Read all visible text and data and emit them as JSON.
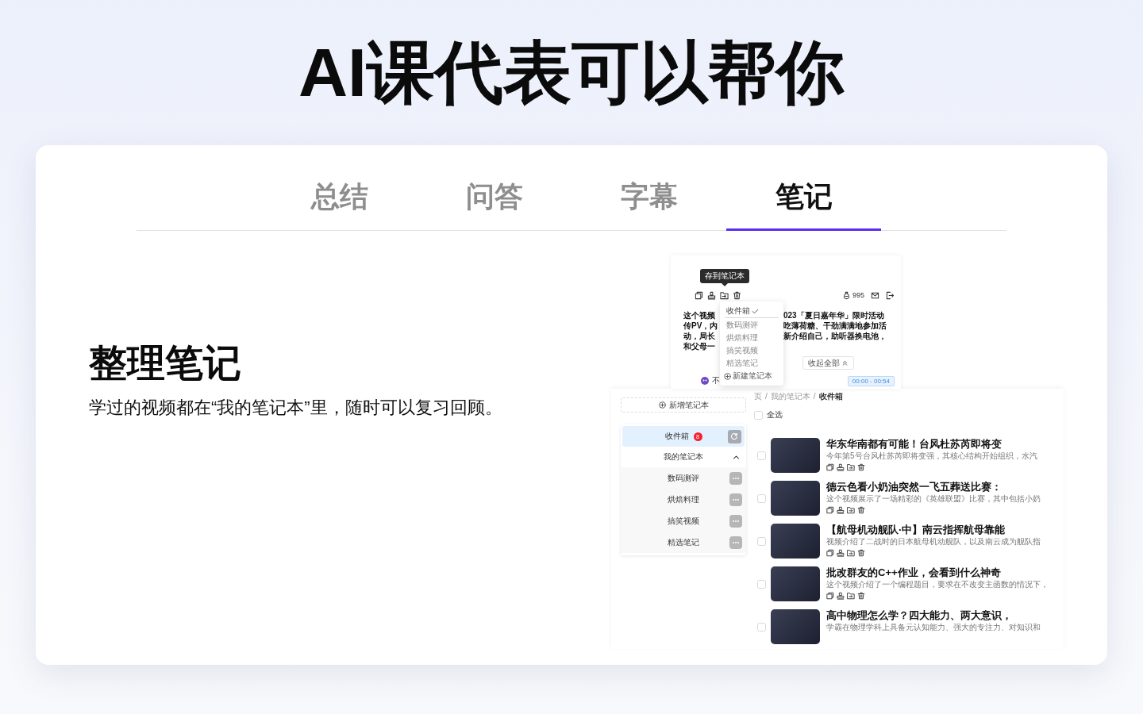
{
  "headline": "AI课代表可以帮你",
  "tabs": [
    {
      "label": "总结",
      "selected": false
    },
    {
      "label": "问答",
      "selected": false
    },
    {
      "label": "字幕",
      "selected": false
    },
    {
      "label": "笔记",
      "selected": true
    }
  ],
  "feature": {
    "title": "整理笔记",
    "description": "学过的视频都在“我的笔记本”里，随时可以复习回顾。"
  },
  "note_popup": {
    "tooltip": "存到笔记本",
    "coin_count": "995",
    "text_left": [
      "这个视频",
      "传PV，内",
      "动，局长",
      "和父母一"
    ],
    "text_right": [
      "023「夏日嘉年华」限时活动",
      "吃薄荷糖、干劲满满地参加活",
      "新介绍自己，助听器换电池，"
    ],
    "menu": {
      "items": [
        {
          "label": "收件箱",
          "selected": true
        },
        {
          "label": "数码测评",
          "selected": false
        },
        {
          "label": "烘焙料理",
          "selected": false
        },
        {
          "label": "搞笑视频",
          "selected": false
        },
        {
          "label": "精选笔记",
          "selected": false
        }
      ],
      "new_label": "新建笔记本"
    },
    "collapse_button": "收起全部",
    "speaker_text": "不",
    "time_range": "00:00 - 00:54"
  },
  "notebook_panel": {
    "new_button": "新增笔记本",
    "sidebar": [
      {
        "kind": "inbox",
        "label": "收件箱",
        "selected": true,
        "badge": "8"
      },
      {
        "kind": "group",
        "label": "我的笔记本",
        "selected": false,
        "expanded": true,
        "children": [
          {
            "label": "数码测评",
            "selected": false
          },
          {
            "label": "烘焙料理",
            "selected": false
          },
          {
            "label": "搞笑视频",
            "selected": false
          },
          {
            "label": "精选笔记",
            "selected": false
          }
        ]
      }
    ],
    "breadcrumb": {
      "separator": "/",
      "items": [
        {
          "label": "页",
          "current": false
        },
        {
          "label": "我的笔记本",
          "current": false
        },
        {
          "label": "收件箱",
          "current": true
        }
      ]
    },
    "select_all": {
      "label": "全选",
      "checked": false
    },
    "videos": [
      {
        "title": "华东华南都有可能！台风杜苏芮即将变",
        "description": "今年第5号台风杜苏芮即将变强，其核心结构开始组织，水汽",
        "checked": false,
        "show_actions": true
      },
      {
        "title": "德云色看小奶油突然一飞五葬送比赛：",
        "description": "这个视频展示了一场精彩的《英雄联盟》比赛，其中包括小奶",
        "checked": false,
        "show_actions": true
      },
      {
        "title": "【航母机动舰队·中】南云指挥航母靠能",
        "description": "视频介绍了二战时的日本航母机动舰队，以及南云成为舰队指",
        "checked": false,
        "show_actions": true
      },
      {
        "title": "批改群友的C++作业，会看到什么神奇",
        "description": "这个视频介绍了一个编程题目，要求在不改变主函数的情况下，",
        "checked": false,
        "show_actions": true
      },
      {
        "title": "高中物理怎么学？四大能力、两大意识，",
        "description": "学霸在物理学科上具备元认知能力、强大的专注力、对知识和",
        "checked": false,
        "show_actions": false
      }
    ]
  }
}
